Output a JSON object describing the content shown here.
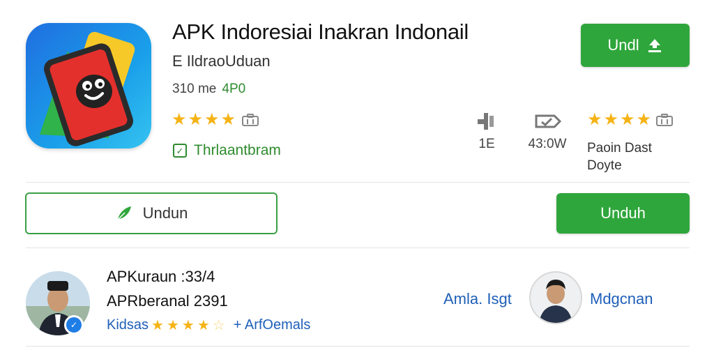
{
  "app": {
    "title": "APK Indoresiai Inakran Indonail",
    "developer": "E IldraoUduan",
    "size": "310 me",
    "badge": "4P0",
    "rating_stars": 4,
    "verified_label": "Thrlaantbram",
    "icon": "phone-face-app-icon"
  },
  "header_button": {
    "label": "Undl",
    "icon": "download-icon"
  },
  "stats": [
    {
      "icon": "signal-icon",
      "value": "1E"
    },
    {
      "icon": "tag-icon",
      "value": "43:0W"
    }
  ],
  "side_rating": {
    "stars": 4,
    "label_line1": "Paoin Dast",
    "label_line2": "Doyte"
  },
  "action_buttons": {
    "outline_label": "Undun",
    "outline_icon": "leaf-icon",
    "solid_label": "Unduh"
  },
  "review": {
    "line1": "APKuraun :33/4",
    "line2": "APRberanal 2391",
    "meta_label": "Kidsas",
    "stars": 4,
    "meta_extra": "+ ArfOemals",
    "link_text": "Amla. Isgt",
    "author_name": "Mdgcnan"
  },
  "colors": {
    "primary_green": "#2fa63b",
    "star_yellow": "#f5b316",
    "link_blue": "#1e5fb8",
    "icon_blue": "#1f6fe0"
  }
}
